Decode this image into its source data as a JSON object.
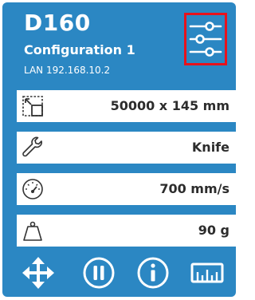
{
  "header": {
    "device_name": "D160",
    "configuration": "Configuration 1",
    "network": "LAN 192.168.10.2"
  },
  "parameters": [
    {
      "icon": "material-size-icon",
      "value": "50000 x 145 mm"
    },
    {
      "icon": "wrench-tool-icon",
      "value": "Knife"
    },
    {
      "icon": "speedometer-icon",
      "value": "700 mm/s"
    },
    {
      "icon": "weight-pressure-icon",
      "value": "90 g"
    }
  ],
  "toolbar": {
    "settings_icon": "sliders-settings-icon",
    "buttons": [
      {
        "icon": "move-arrows-icon"
      },
      {
        "icon": "pause-icon"
      },
      {
        "icon": "info-icon"
      },
      {
        "icon": "ruler-icon"
      }
    ]
  },
  "colors": {
    "panel_blue": "#2b87c3",
    "highlight_red": "#e8121c",
    "row_background": "#ffffff",
    "value_text": "#2c2c2c"
  }
}
